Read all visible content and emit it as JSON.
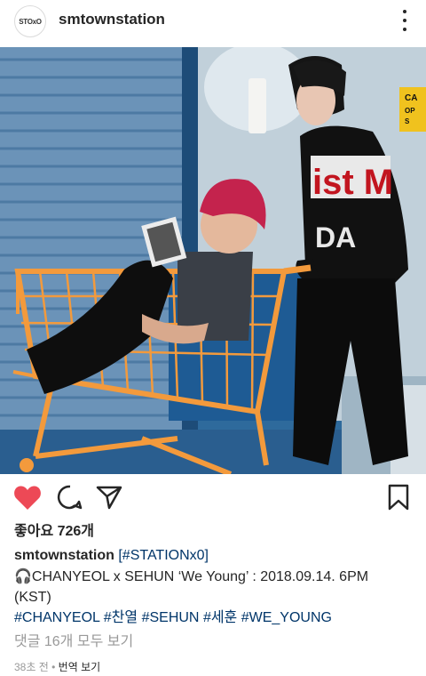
{
  "header": {
    "avatar_text": "STOxO",
    "username": "smtownstation"
  },
  "post": {
    "liked": true,
    "likes_label": "좋아요 726개",
    "caption": {
      "username": "smtownstation",
      "first_tag": "[#STATIONx0]",
      "line2": "🎧CHANYEOL x SEHUN ‘We Young’ : 2018.09.14. 6PM",
      "line3": "(KST)",
      "tags": [
        "#CHANYEOL",
        "#찬열",
        "#SEHUN",
        "#세훈",
        "#WE_YOUNG"
      ]
    },
    "view_comments": "댓글 16개 모두 보기",
    "time_ago": "38초 전",
    "translate": "번역 보기"
  },
  "photo": {
    "sign_text": [
      "CA",
      "OP",
      "S"
    ],
    "jacket_letters": "ist M",
    "jacket_letters2": "DA"
  },
  "colors": {
    "heart": "#ed4956",
    "link": "#003569",
    "muted": "#999999",
    "cart": "#f39a3c"
  }
}
